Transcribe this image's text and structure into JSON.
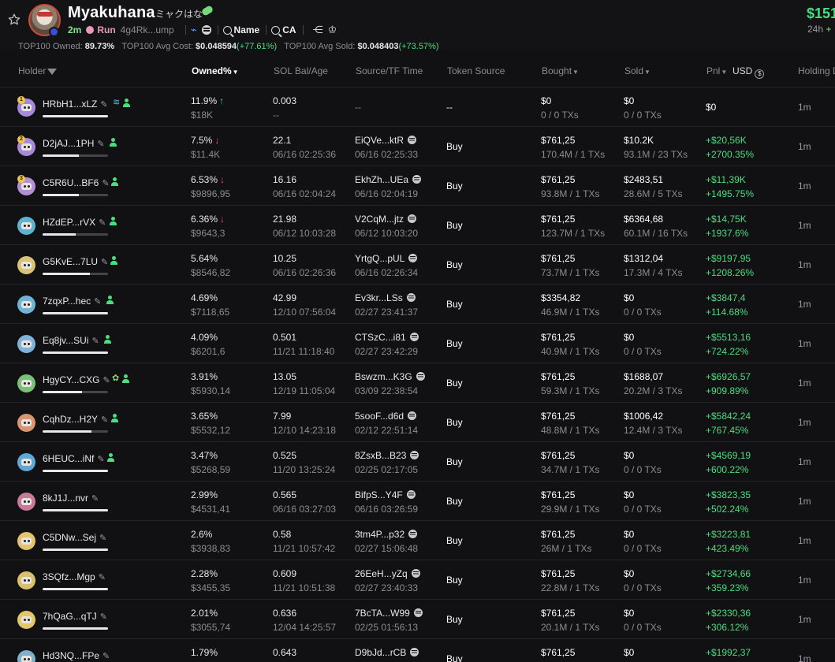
{
  "header": {
    "token_name": "Myakuhana",
    "token_jp": "ミャクはな",
    "age": "2m",
    "run_label": "Run",
    "ca_short": "4g4Rk...ump",
    "name_search": "Name",
    "ca_search": "CA",
    "price": "$151",
    "price_window": "24h",
    "price_change": "+"
  },
  "summary": {
    "owned_label": "TOP100 Owned:",
    "owned_value": "89.73%",
    "cost_label": "TOP100 Avg Cost:",
    "cost_value": "$0.048594",
    "cost_change": "(+77.61%)",
    "sold_label": "TOP100 Avg Sold:",
    "sold_value": "$0.048403",
    "sold_change": "(+73.57%)"
  },
  "columns": {
    "holder": "Holder",
    "owned": "Owned%",
    "sol_bal": "SOL Bal/Age",
    "source": "Source/TF Time",
    "token_source": "Token Source",
    "bought": "Bought",
    "sold": "Sold",
    "pnl": "Pnl",
    "usd": "USD",
    "holding": "Holding D"
  },
  "colors": {
    "positive": "#4ade80",
    "negative": "#ef5350",
    "muted": "#8b8b93"
  },
  "rows": [
    {
      "rank": "1",
      "avatar": "#a689d8",
      "addr": "HRbH1...xLZ",
      "person": true,
      "extra": "fish-icon",
      "bar": 1.0,
      "pct": "11.9%",
      "trend": "up",
      "owned_usd": "$18K",
      "sol": "0.003",
      "age": "--",
      "src": "--",
      "src_icon": false,
      "src_time": "",
      "token_src": "--",
      "bought": "$0",
      "bought_sub": "0 / 0 TXs",
      "sold": "$0",
      "sold_sub": "0 / 0 TXs",
      "pnl": "$0",
      "pnl_pct": "",
      "hold": "1m"
    },
    {
      "rank": "2",
      "avatar": "#a689d8",
      "addr": "D2jAJ...1PH",
      "person": true,
      "extra": "",
      "bar": 0.55,
      "pct": "7.5%",
      "trend": "down",
      "owned_usd": "$11.4K",
      "sol": "22.1",
      "age": "06/16 02:25:36",
      "src": "EiQVe...ktR",
      "src_icon": true,
      "src_time": "06/16 02:25:33",
      "token_src": "Buy",
      "bought": "$761,25",
      "bought_sub": "170.4M / 1 TXs",
      "sold": "$10.2K",
      "sold_sub": "93.1M / 23 TXs",
      "pnl": "+$20,56K",
      "pnl_pct": "+2700.35%",
      "hold": "1m"
    },
    {
      "rank": "3",
      "avatar": "#b48fd6",
      "addr": "C5R6U...BF6",
      "person": true,
      "extra": "",
      "bar": 0.55,
      "pct": "6.53%",
      "trend": "down",
      "owned_usd": "$9896,95",
      "sol": "16.16",
      "age": "06/16 02:04:24",
      "src": "EkhZh...UEa",
      "src_icon": true,
      "src_time": "06/16 02:04:19",
      "token_src": "Buy",
      "bought": "$761,25",
      "bought_sub": "93.8M / 1 TXs",
      "sold": "$2483,51",
      "sold_sub": "28.6M / 5 TXs",
      "pnl": "+$11,39K",
      "pnl_pct": "+1495.75%",
      "hold": "1m"
    },
    {
      "rank": "",
      "avatar": "#5fb3cf",
      "addr": "HZdEP...rVX",
      "person": true,
      "extra": "",
      "bar": 0.5,
      "pct": "6.36%",
      "trend": "down",
      "owned_usd": "$9643,3",
      "sol": "21.98",
      "age": "06/12 10:03:28",
      "src": "V2CqM...jtz",
      "src_icon": true,
      "src_time": "06/12 10:03:20",
      "token_src": "Buy",
      "bought": "$761,25",
      "bought_sub": "123.7M / 1 TXs",
      "sold": "$6364,68",
      "sold_sub": "60.1M / 16 TXs",
      "pnl": "+$14,75K",
      "pnl_pct": "+1937.6%",
      "hold": "1m"
    },
    {
      "rank": "",
      "avatar": "#d9c27a",
      "addr": "G5KvE...7LU",
      "person": true,
      "extra": "",
      "bar": 0.72,
      "pct": "5.64%",
      "trend": "",
      "owned_usd": "$8546,82",
      "sol": "10.25",
      "age": "06/16 02:26:36",
      "src": "YrtgQ...pUL",
      "src_icon": true,
      "src_time": "06/16 02:26:34",
      "token_src": "Buy",
      "bought": "$761,25",
      "bought_sub": "73.7M / 1 TXs",
      "sold": "$1312,04",
      "sold_sub": "17.3M / 4 TXs",
      "pnl": "+$9197,95",
      "pnl_pct": "+1208.26%",
      "hold": "1m"
    },
    {
      "rank": "",
      "avatar": "#6fb3d6",
      "addr": "7zqxP...hec",
      "person": true,
      "extra": "",
      "bar": 1.0,
      "pct": "4.69%",
      "trend": "",
      "owned_usd": "$7118,65",
      "sol": "42.99",
      "age": "12/10 07:56:04",
      "src": "Ev3kr...LSs",
      "src_icon": true,
      "src_time": "02/27 23:41:37",
      "token_src": "Buy",
      "bought": "$3354,82",
      "bought_sub": "46.9M / 1 TXs",
      "sold": "$0",
      "sold_sub": "0 / 0 TXs",
      "pnl": "+$3847,4",
      "pnl_pct": "+114.68%",
      "hold": "1m"
    },
    {
      "rank": "",
      "avatar": "#7fb3d9",
      "addr": "Eq8jv...SUi",
      "person": true,
      "extra": "",
      "bar": 1.0,
      "pct": "4.09%",
      "trend": "",
      "owned_usd": "$6201,6",
      "sol": "0.501",
      "age": "11/21 11:18:40",
      "src": "CTSzC...i81",
      "src_icon": true,
      "src_time": "02/27 23:42:29",
      "token_src": "Buy",
      "bought": "$761,25",
      "bought_sub": "40.9M / 1 TXs",
      "sold": "$0",
      "sold_sub": "0 / 0 TXs",
      "pnl": "+$5513,16",
      "pnl_pct": "+724.22%",
      "hold": "1m"
    },
    {
      "rank": "",
      "avatar": "#7cbf7a",
      "addr": "HgyCY...CXG",
      "person": true,
      "extra": "frog-icon",
      "bar": 0.6,
      "pct": "3.91%",
      "trend": "",
      "owned_usd": "$5930,14",
      "sol": "13.05",
      "age": "12/19 11:05:04",
      "src": "Bswzm...K3G",
      "src_icon": true,
      "src_time": "03/09 22:38:54",
      "token_src": "Buy",
      "bought": "$761,25",
      "bought_sub": "59.3M / 1 TXs",
      "sold": "$1688,07",
      "sold_sub": "20.2M / 3 TXs",
      "pnl": "+$6926,57",
      "pnl_pct": "+909.89%",
      "hold": "1m"
    },
    {
      "rank": "",
      "avatar": "#d9956f",
      "addr": "CqhDz...H2Y",
      "person": true,
      "extra": "",
      "bar": 0.75,
      "pct": "3.65%",
      "trend": "",
      "owned_usd": "$5532,12",
      "sol": "7.99",
      "age": "12/10 14:23:18",
      "src": "5sooF...d6d",
      "src_icon": true,
      "src_time": "02/12 22:51:14",
      "token_src": "Buy",
      "bought": "$761,25",
      "bought_sub": "48.8M / 1 TXs",
      "sold": "$1006,42",
      "sold_sub": "12.4M / 3 TXs",
      "pnl": "+$5842,24",
      "pnl_pct": "+767.45%",
      "hold": "1m"
    },
    {
      "rank": "",
      "avatar": "#5fa7d6",
      "addr": "6HEUC...iNf",
      "person": true,
      "extra": "",
      "bar": 1.0,
      "pct": "3.47%",
      "trend": "",
      "owned_usd": "$5268,59",
      "sol": "0.525",
      "age": "11/20 13:25:24",
      "src": "8ZsxB...B23",
      "src_icon": true,
      "src_time": "02/25 02:17:05",
      "token_src": "Buy",
      "bought": "$761,25",
      "bought_sub": "34.7M / 1 TXs",
      "sold": "$0",
      "sold_sub": "0 / 0 TXs",
      "pnl": "+$4569,19",
      "pnl_pct": "+600.22%",
      "hold": "1m"
    },
    {
      "rank": "",
      "avatar": "#c97a9a",
      "addr": "8kJ1J...nvr",
      "person": false,
      "extra": "",
      "bar": 1.0,
      "pct": "2.99%",
      "trend": "",
      "owned_usd": "$4531,41",
      "sol": "0.565",
      "age": "06/16 03:27:03",
      "src": "BifpS...Y4F",
      "src_icon": true,
      "src_time": "06/16 03:26:59",
      "token_src": "Buy",
      "bought": "$761,25",
      "bought_sub": "29.9M / 1 TXs",
      "sold": "$0",
      "sold_sub": "0 / 0 TXs",
      "pnl": "+$3823,35",
      "pnl_pct": "+502.24%",
      "hold": "1m"
    },
    {
      "rank": "",
      "avatar": "#e3c36f",
      "addr": "C5DNw...Sej",
      "person": false,
      "extra": "",
      "bar": 1.0,
      "pct": "2.6%",
      "trend": "",
      "owned_usd": "$3938,83",
      "sol": "0.58",
      "age": "11/21 10:57:42",
      "src": "3tm4P...p32",
      "src_icon": true,
      "src_time": "02/27 15:06:48",
      "token_src": "Buy",
      "bought": "$761,25",
      "bought_sub": "26M / 1 TXs",
      "sold": "$0",
      "sold_sub": "0 / 0 TXs",
      "pnl": "+$3223,81",
      "pnl_pct": "+423.49%",
      "hold": "1m"
    },
    {
      "rank": "",
      "avatar": "#d9c06a",
      "addr": "3SQfz...Mgp",
      "person": false,
      "extra": "",
      "bar": 1.0,
      "pct": "2.28%",
      "trend": "",
      "owned_usd": "$3455,35",
      "sol": "0.609",
      "age": "11/21 10:51:38",
      "src": "26EeH...yZq",
      "src_icon": true,
      "src_time": "02/27 23:40:33",
      "token_src": "Buy",
      "bought": "$761,25",
      "bought_sub": "22.8M / 1 TXs",
      "sold": "$0",
      "sold_sub": "0 / 0 TXs",
      "pnl": "+$2734,66",
      "pnl_pct": "+359.23%",
      "hold": "1m"
    },
    {
      "rank": "",
      "avatar": "#e0c86a",
      "addr": "7hQaG...qTJ",
      "person": false,
      "extra": "",
      "bar": 1.0,
      "pct": "2.01%",
      "trend": "",
      "owned_usd": "$3055,74",
      "sol": "0.636",
      "age": "12/04 14:25:57",
      "src": "7BcTA...W99",
      "src_icon": true,
      "src_time": "02/25 01:56:13",
      "token_src": "Buy",
      "bought": "$761,25",
      "bought_sub": "20.1M / 1 TXs",
      "sold": "$0",
      "sold_sub": "0 / 0 TXs",
      "pnl": "+$2330,36",
      "pnl_pct": "+306.12%",
      "hold": "1m"
    },
    {
      "rank": "",
      "avatar": "#7fb0c9",
      "addr": "Hd3NQ...FPe",
      "person": false,
      "extra": "",
      "bar": 1.0,
      "pct": "1.79%",
      "trend": "",
      "owned_usd": "",
      "sol": "0.643",
      "age": "",
      "src": "D9bJd...rCB",
      "src_icon": true,
      "src_time": "",
      "token_src": "Buy",
      "bought": "$761,25",
      "bought_sub": "",
      "sold": "$0",
      "sold_sub": "",
      "pnl": "+$1992,37",
      "pnl_pct": "",
      "hold": "1m"
    }
  ]
}
